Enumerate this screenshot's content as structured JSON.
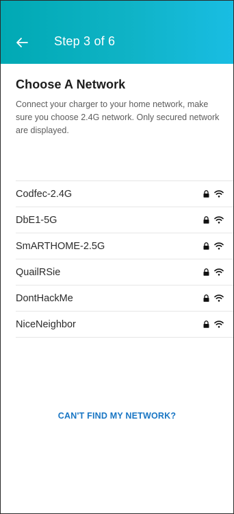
{
  "header": {
    "back_icon": "arrow-left-icon",
    "title": "Step 3 of 6",
    "gradient_start": "#00a9b4",
    "gradient_end": "#19bde3"
  },
  "intro": {
    "heading": "Choose A Network",
    "description": "Connect your charger to your home network, make sure you choose 2.4G network. Only secured network are displayed."
  },
  "networks": [
    {
      "ssid": "Codfec-2.4G",
      "secured": true,
      "icons": [
        "lock-icon",
        "wifi-icon"
      ]
    },
    {
      "ssid": "DbE1-5G",
      "secured": true,
      "icons": [
        "lock-icon",
        "wifi-icon"
      ]
    },
    {
      "ssid": "SmARTHOME-2.5G",
      "secured": true,
      "icons": [
        "lock-icon",
        "wifi-icon"
      ]
    },
    {
      "ssid": "QuailRSie",
      "secured": true,
      "icons": [
        "lock-icon",
        "wifi-icon"
      ]
    },
    {
      "ssid": "DontHackMe",
      "secured": true,
      "icons": [
        "lock-icon",
        "wifi-icon"
      ]
    },
    {
      "ssid": "NiceNeighbor",
      "secured": true,
      "icons": [
        "lock-icon",
        "wifi-icon"
      ]
    }
  ],
  "footer": {
    "cant_find_label": "CAN'T FIND MY NETWORK?",
    "link_color": "#1976c4"
  }
}
